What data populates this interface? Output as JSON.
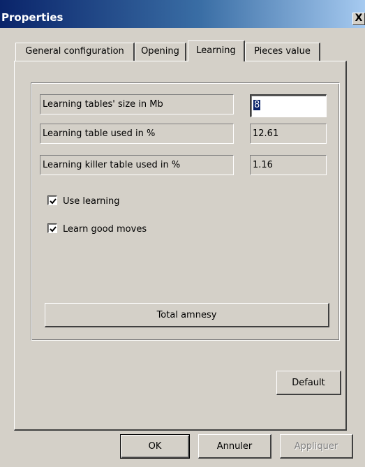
{
  "window": {
    "title": "Properties",
    "close_glyph": "X"
  },
  "tabs": [
    {
      "label": "General configuration",
      "active": false
    },
    {
      "label": "Opening",
      "active": false
    },
    {
      "label": "Learning",
      "active": true
    },
    {
      "label": "Pieces value",
      "active": false
    }
  ],
  "learning": {
    "table_size_label": "Learning tables' size in Mb",
    "table_size_value": "8",
    "table_used_label": "Learning table used in %",
    "table_used_value": "12.61",
    "killer_used_label": "Learning killer table used in %",
    "killer_used_value": "1.16",
    "use_learning_label": "Use learning",
    "use_learning_checked": true,
    "learn_good_moves_label": "Learn good moves",
    "learn_good_moves_checked": true,
    "total_amnesy_label": "Total amnesy"
  },
  "buttons": {
    "default_label": "Default",
    "ok_label": "OK",
    "cancel_label": "Annuler",
    "apply_label": "Appliquer",
    "apply_enabled": false
  },
  "colors": {
    "title_gradient_start": "#0a246a",
    "title_gradient_end": "#a6caf0",
    "face": "#d4d0c8",
    "selection": "#0a246a"
  },
  "icons": {
    "close": "close-icon",
    "check": "checkmark-icon"
  }
}
